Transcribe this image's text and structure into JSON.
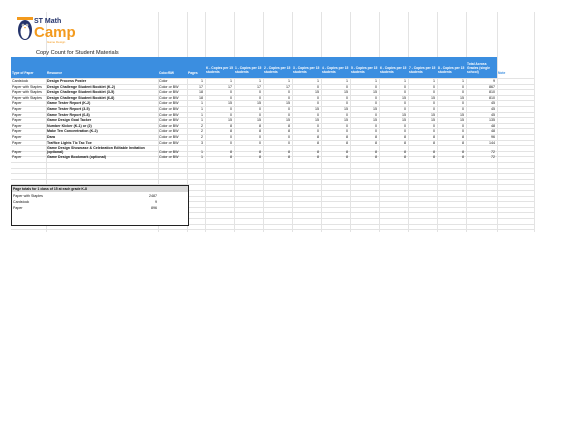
{
  "logo": {
    "brand_top": "ST Math",
    "brand_word": "Camp",
    "brand_sub": "Game Design"
  },
  "title": "Copy Count for Student Materials",
  "headers": [
    "Type of Paper",
    "Resource",
    "Color/BW",
    "Pages",
    "K - Copies per 15 students",
    "1 - Copies per 15 students",
    "2 - Copies per 15 students",
    "3 - Copies per 15 students",
    "4 - Copies per 15 students",
    "5 - Copies per 15 students",
    "6 - Copies per 15 students",
    "7 - Copies per 15 students",
    "8 - Copies per 15 students",
    "Total Across Grades (single school)",
    "Note"
  ],
  "rows": [
    {
      "type": "Cardstock",
      "resource": "Design Process Poster",
      "color": "Color",
      "pages": "1",
      "copies": [
        "1",
        "1",
        "1",
        "1",
        "1",
        "1",
        "1",
        "1",
        "1"
      ],
      "total": "9",
      "note": ""
    },
    {
      "type": "Paper with Staples",
      "resource": "Design Challenge Student Booklet (K-2)",
      "color": "Color or BW",
      "pages": "17",
      "copies": [
        "17",
        "17",
        "17",
        "0",
        "0",
        "0",
        "0",
        "0",
        "0"
      ],
      "total": "867",
      "note": ""
    },
    {
      "type": "Paper with Staples",
      "resource": "Design Challenge Student Booklet (3-5)",
      "color": "Color or BW",
      "pages": "18",
      "copies": [
        "0",
        "0",
        "0",
        "15",
        "15",
        "15",
        "0",
        "0",
        "0"
      ],
      "total": "810",
      "note": ""
    },
    {
      "type": "Paper with Staples",
      "resource": "Design Challenge Student Booklet (6-8)",
      "color": "Color or BW",
      "pages": "18",
      "copies": [
        "0",
        "0",
        "0",
        "0",
        "0",
        "0",
        "15",
        "15",
        "15"
      ],
      "total": "810",
      "note": ""
    },
    {
      "type": "Paper",
      "resource": "Game Tester Report (K-2)",
      "color": "Color or BW",
      "pages": "1",
      "copies": [
        "15",
        "15",
        "15",
        "0",
        "0",
        "0",
        "0",
        "0",
        "0"
      ],
      "total": "45",
      "note": ""
    },
    {
      "type": "Paper",
      "resource": "Game Tester Report (3-5)",
      "color": "Color or BW",
      "pages": "1",
      "copies": [
        "0",
        "0",
        "0",
        "15",
        "15",
        "15",
        "0",
        "0",
        "0"
      ],
      "total": "45",
      "note": ""
    },
    {
      "type": "Paper",
      "resource": "Game Tester Report (6-8)",
      "color": "Color or BW",
      "pages": "1",
      "copies": [
        "0",
        "0",
        "0",
        "0",
        "0",
        "0",
        "15",
        "15",
        "15"
      ],
      "total": "45",
      "note": ""
    },
    {
      "type": "Paper",
      "resource": "Game Design Goal Tacker",
      "color": "Color or BW",
      "pages": "1",
      "copies": [
        "15",
        "15",
        "15",
        "15",
        "15",
        "15",
        "15",
        "15",
        "15"
      ],
      "total": "135",
      "note": ""
    },
    {
      "type": "Paper",
      "resource": "Number Kicker (K-1) or (2)",
      "color": "Color or BW",
      "pages": "2",
      "copies": [
        "8",
        "8",
        "8",
        "0",
        "0",
        "0",
        "0",
        "0",
        "0"
      ],
      "total": "48",
      "note": ""
    },
    {
      "type": "Paper",
      "resource": "Make Ten Concentration (K-2)",
      "color": "Color or BW",
      "pages": "2",
      "copies": [
        "8",
        "8",
        "8",
        "0",
        "0",
        "0",
        "0",
        "0",
        "0"
      ],
      "total": "48",
      "note": ""
    },
    {
      "type": "Paper",
      "resource": "Dara",
      "color": "Color or BW",
      "pages": "2",
      "copies": [
        "0",
        "0",
        "0",
        "8",
        "8",
        "8",
        "8",
        "8",
        "8"
      ],
      "total": "96",
      "note": ""
    },
    {
      "type": "Paper",
      "resource": "Traffice Lights Tic Tac Toe",
      "color": "Color or BW",
      "pages": "3",
      "copies": [
        "0",
        "0",
        "0",
        "8",
        "8",
        "8",
        "8",
        "8",
        "8"
      ],
      "total": "144",
      "note": ""
    },
    {
      "type": "Paper",
      "resource": "Game Design Showcase & Celebration Editable Invitation (optional)",
      "color": "Color or BW",
      "pages": "1",
      "copies": [
        "8",
        "8",
        "8",
        "8",
        "8",
        "8",
        "8",
        "8",
        "8"
      ],
      "total": "72",
      "note": ""
    },
    {
      "type": "Paper",
      "resource": "Game Design Bookmark (optional)",
      "color": "Color or BW",
      "pages": "1",
      "copies": [
        "8",
        "8",
        "8",
        "8",
        "8",
        "8",
        "8",
        "8",
        "8"
      ],
      "total": "72",
      "note": ""
    }
  ],
  "totals": {
    "title": "Page totals for 1 class of 15 at each grade K-8",
    "items": [
      {
        "label": "Paper with Staples",
        "value": "2487"
      },
      {
        "label": "Cardstock",
        "value": "9"
      },
      {
        "label": "Paper",
        "value": "896"
      }
    ]
  }
}
